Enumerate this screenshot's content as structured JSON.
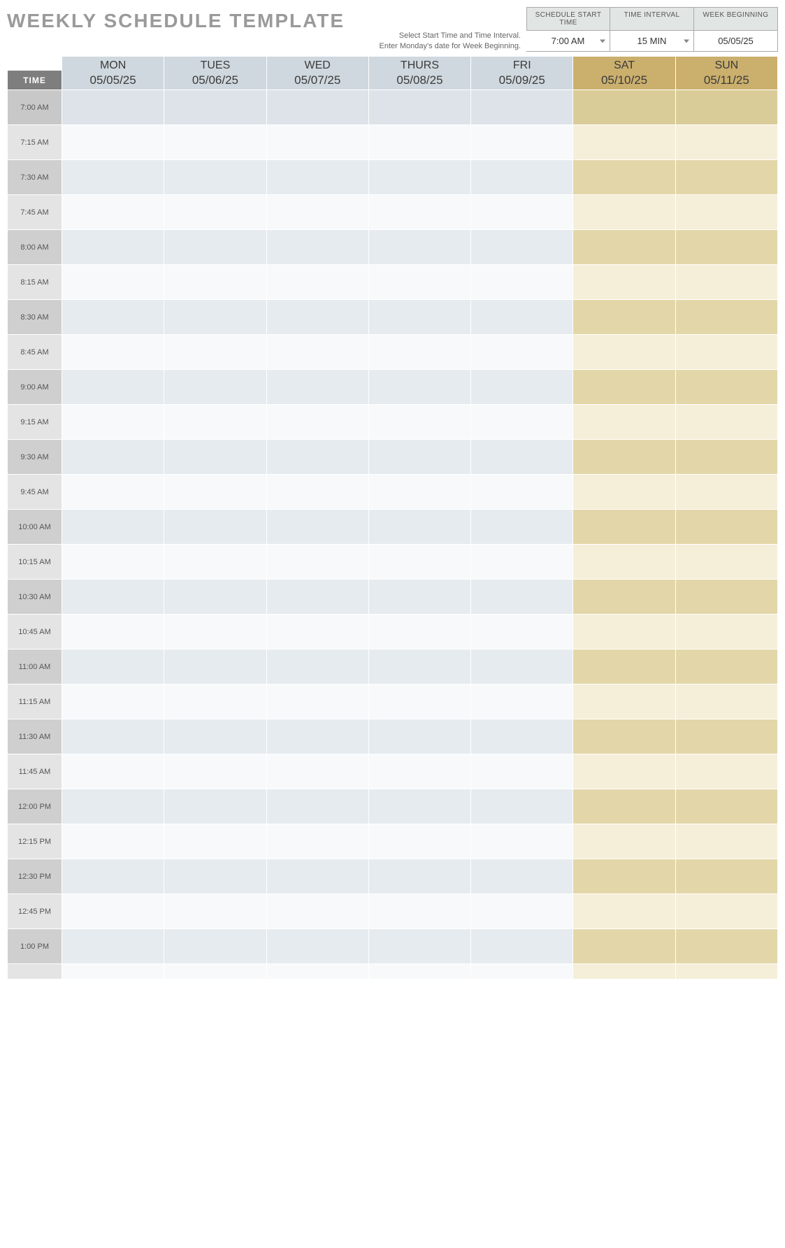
{
  "title": "WEEKLY SCHEDULE TEMPLATE",
  "hint_line1": "Select Start Time and Time Interval.",
  "hint_line2": "Enter Monday's date for Week Beginning.",
  "controls": {
    "start_time": {
      "label": "SCHEDULE START TIME",
      "value": "7:00 AM"
    },
    "interval": {
      "label": "TIME INTERVAL",
      "value": "15 MIN"
    },
    "week_begin": {
      "label": "WEEK BEGINNING",
      "value": "05/05/25"
    }
  },
  "time_header": "TIME",
  "days": [
    {
      "dow": "MON",
      "date": "05/05/25",
      "type": "weekday"
    },
    {
      "dow": "TUES",
      "date": "05/06/25",
      "type": "weekday"
    },
    {
      "dow": "WED",
      "date": "05/07/25",
      "type": "weekday"
    },
    {
      "dow": "THURS",
      "date": "05/08/25",
      "type": "weekday"
    },
    {
      "dow": "FRI",
      "date": "05/09/25",
      "type": "weekday"
    },
    {
      "dow": "SAT",
      "date": "05/10/25",
      "type": "weekend"
    },
    {
      "dow": "SUN",
      "date": "05/11/25",
      "type": "weekend"
    }
  ],
  "times": [
    "7:00 AM",
    "7:15 AM",
    "7:30 AM",
    "7:45 AM",
    "8:00 AM",
    "8:15 AM",
    "8:30 AM",
    "8:45 AM",
    "9:00 AM",
    "9:15 AM",
    "9:30 AM",
    "9:45 AM",
    "10:00 AM",
    "10:15 AM",
    "10:30 AM",
    "10:45 AM",
    "11:00 AM",
    "11:15 AM",
    "11:30 AM",
    "11:45 AM",
    "12:00 PM",
    "12:15 PM",
    "12:30 PM",
    "12:45 PM",
    "1:00 PM"
  ]
}
